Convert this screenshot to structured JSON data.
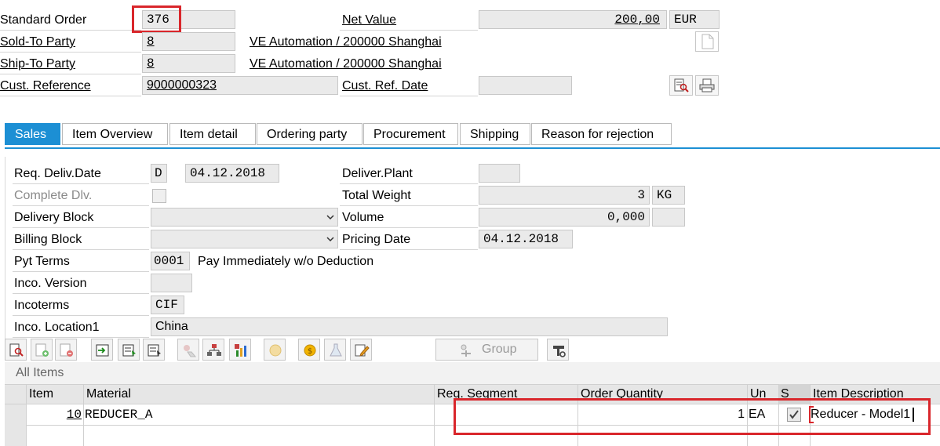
{
  "header": {
    "standard_order_label": "Standard Order",
    "standard_order_value": "376",
    "net_value_label": "Net Value",
    "net_value": "200,00",
    "currency": "EUR",
    "sold_to_label": "Sold-To Party",
    "sold_to_value": "8",
    "sold_to_name": "VE Automation / 200000 Shanghai",
    "ship_to_label": "Ship-To Party",
    "ship_to_value": "8",
    "ship_to_name": "VE Automation / 200000 Shanghai",
    "cust_ref_label": "Cust. Reference",
    "cust_ref_value": "9000000323",
    "cust_ref_date_label": "Cust. Ref. Date",
    "cust_ref_date_value": ""
  },
  "tabs": [
    "Sales",
    "Item Overview",
    "Item detail",
    "Ordering party",
    "Procurement",
    "Shipping",
    "Reason for rejection"
  ],
  "sales": {
    "req_deliv_date_label": "Req. Deliv.Date",
    "req_deliv_date_type": "D",
    "req_deliv_date": "04.12.2018",
    "complete_dlv_label": "Complete Dlv.",
    "delivery_block_label": "Delivery Block",
    "billing_block_label": "Billing Block",
    "pyt_terms_label": "Pyt Terms",
    "pyt_terms_code": "0001",
    "pyt_terms_text": "Pay Immediately w/o Deduction",
    "inco_version_label": "Inco. Version",
    "incoterms_label": "Incoterms",
    "incoterms_value": "CIF",
    "inco_location_label": "Inco. Location1",
    "inco_location_value": "China",
    "deliver_plant_label": "Deliver.Plant",
    "total_weight_label": "Total Weight",
    "total_weight_value": "3",
    "total_weight_unit": "KG",
    "volume_label": "Volume",
    "volume_value": "0,000",
    "pricing_date_label": "Pricing Date",
    "pricing_date_value": "04.12.2018"
  },
  "toolbar": {
    "group_label": "Group"
  },
  "items": {
    "section_title": "All Items",
    "columns": {
      "item": "Item",
      "material": "Material",
      "req_segment": "Req. Segment",
      "order_quantity": "Order Quantity",
      "unit": "Un",
      "s": "S",
      "item_description": "Item Description"
    },
    "rows": [
      {
        "item": "10",
        "material": "REDUCER_A",
        "req_segment": "",
        "order_quantity": "1",
        "unit": "EA",
        "s_checked": true,
        "item_description": "Reducer - Model1"
      }
    ]
  },
  "colors": {
    "accent": "#1c8fd4",
    "highlight": "#d9262b",
    "field_bg": "#eaeaea"
  }
}
